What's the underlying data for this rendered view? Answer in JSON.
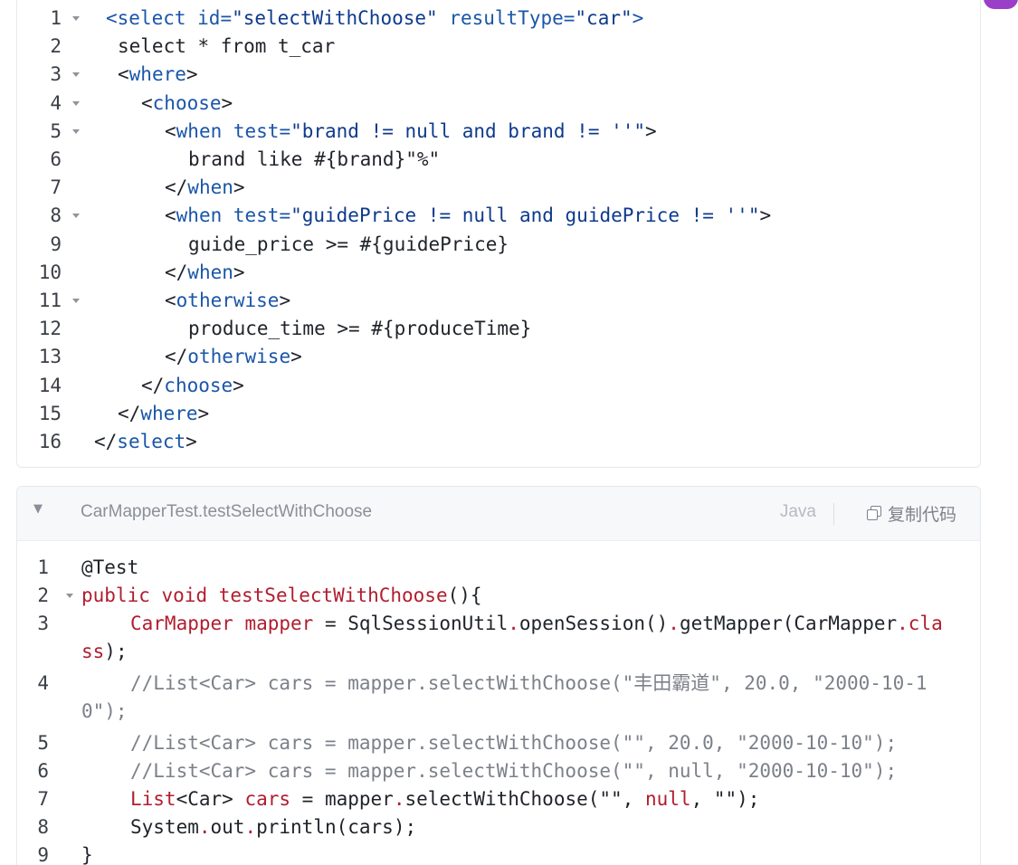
{
  "block1": {
    "lines": [
      {
        "n": "1",
        "parts": [
          [
            "k",
            "<select "
          ],
          [
            "k",
            "id="
          ],
          [
            "s",
            "\"selectWithChoose\""
          ],
          [
            "t",
            " "
          ],
          [
            "k",
            "resultType="
          ],
          [
            "s",
            "\"car\""
          ],
          [
            "k",
            ">"
          ]
        ]
      },
      {
        "n": "2",
        "parts": [
          [
            "t",
            "select * from t_car"
          ]
        ]
      },
      {
        "n": "3",
        "parts": [
          [
            "t",
            "<"
          ],
          [
            "k",
            "where"
          ],
          [
            "t",
            ">"
          ]
        ]
      },
      {
        "n": "4",
        "parts": [
          [
            "t",
            "<"
          ],
          [
            "k",
            "choose"
          ],
          [
            "t",
            ">"
          ]
        ]
      },
      {
        "n": "5",
        "parts": [
          [
            "t",
            "<"
          ],
          [
            "k",
            "when "
          ],
          [
            "k",
            "test="
          ],
          [
            "s",
            "\"brand != null and brand != ''\""
          ],
          [
            "t",
            ">"
          ]
        ]
      },
      {
        "n": "6",
        "parts": [
          [
            "t",
            "brand like #{brand}\"%\""
          ]
        ]
      },
      {
        "n": "7",
        "parts": [
          [
            "t",
            "</"
          ],
          [
            "k",
            "when"
          ],
          [
            "t",
            ">"
          ]
        ]
      },
      {
        "n": "8",
        "parts": [
          [
            "t",
            "<"
          ],
          [
            "k",
            "when "
          ],
          [
            "k",
            "test="
          ],
          [
            "s",
            "\"guidePrice != null and guidePrice != ''\""
          ],
          [
            "t",
            ">"
          ]
        ]
      },
      {
        "n": "9",
        "parts": [
          [
            "t",
            "guide_price >= #{guidePrice}"
          ]
        ]
      },
      {
        "n": "10",
        "parts": [
          [
            "t",
            "</"
          ],
          [
            "k",
            "when"
          ],
          [
            "t",
            ">"
          ]
        ]
      },
      {
        "n": "11",
        "parts": [
          [
            "t",
            "<"
          ],
          [
            "k",
            "otherwise"
          ],
          [
            "t",
            ">"
          ]
        ]
      },
      {
        "n": "12",
        "parts": [
          [
            "t",
            "produce_time >= #{produceTime}"
          ]
        ]
      },
      {
        "n": "13",
        "parts": [
          [
            "t",
            "</"
          ],
          [
            "k",
            "otherwise"
          ],
          [
            "t",
            ">"
          ]
        ]
      },
      {
        "n": "14",
        "parts": [
          [
            "t",
            "</"
          ],
          [
            "k",
            "choose"
          ],
          [
            "t",
            ">"
          ]
        ]
      },
      {
        "n": "15",
        "parts": [
          [
            "t",
            "</"
          ],
          [
            "k",
            "where"
          ],
          [
            "t",
            ">"
          ]
        ]
      },
      {
        "n": "16",
        "parts": [
          [
            "t",
            "</"
          ],
          [
            "k",
            "select"
          ],
          [
            "t",
            ">"
          ]
        ]
      }
    ]
  },
  "block2": {
    "title": "CarMapperTest.testSelectWithChoose",
    "language": "Java",
    "copy_label": "复制代码",
    "lines": [
      {
        "n": "1",
        "parts": [
          [
            "t",
            "@Test"
          ]
        ]
      },
      {
        "n": "2",
        "parts": [
          [
            "r",
            "public "
          ],
          [
            "r",
            "void "
          ],
          [
            "r",
            "testSelectWithChoose"
          ],
          [
            "t",
            "(){"
          ]
        ]
      },
      {
        "n": "3",
        "parts": [
          [
            "r",
            "CarMapper "
          ],
          [
            "r",
            "mapper "
          ],
          [
            "t",
            "= SqlSessionUtil"
          ],
          [
            "r",
            "."
          ],
          [
            "t",
            "openSession()"
          ],
          [
            "r",
            "."
          ],
          [
            "t",
            "getMapper(CarMapper"
          ],
          [
            "r",
            ".cla"
          ]
        ]
      },
      {
        "n": "",
        "parts": [
          [
            "r",
            "ss"
          ],
          [
            "t",
            ");"
          ]
        ]
      },
      {
        "n": "4",
        "parts": [
          [
            "c",
            "//List<Car> cars = mapper.selectWithChoose(\"丰田霸道\", 20.0, \"2000-10-1"
          ]
        ]
      },
      {
        "n": "",
        "parts": [
          [
            "c",
            "0\");"
          ]
        ]
      },
      {
        "n": "5",
        "parts": [
          [
            "c",
            "//List<Car> cars = mapper.selectWithChoose(\"\", 20.0, \"2000-10-10\");"
          ]
        ]
      },
      {
        "n": "6",
        "parts": [
          [
            "c",
            "//List<Car> cars = mapper.selectWithChoose(\"\", null, \"2000-10-10\");"
          ]
        ]
      },
      {
        "n": "7",
        "parts": [
          [
            "r",
            "List"
          ],
          [
            "t",
            "<Car> "
          ],
          [
            "r",
            "cars "
          ],
          [
            "t",
            "= mapper"
          ],
          [
            "r",
            "."
          ],
          [
            "t",
            "selectWithChoose(\"\", "
          ],
          [
            "r",
            "null"
          ],
          [
            "t",
            ", \"\");"
          ]
        ]
      },
      {
        "n": "8",
        "parts": [
          [
            "t",
            "System"
          ],
          [
            "r",
            "."
          ],
          [
            "t",
            "out"
          ],
          [
            "r",
            "."
          ],
          [
            "t",
            "println(cars);"
          ]
        ]
      },
      {
        "n": "9",
        "parts": [
          [
            "t",
            "}"
          ]
        ]
      }
    ]
  }
}
